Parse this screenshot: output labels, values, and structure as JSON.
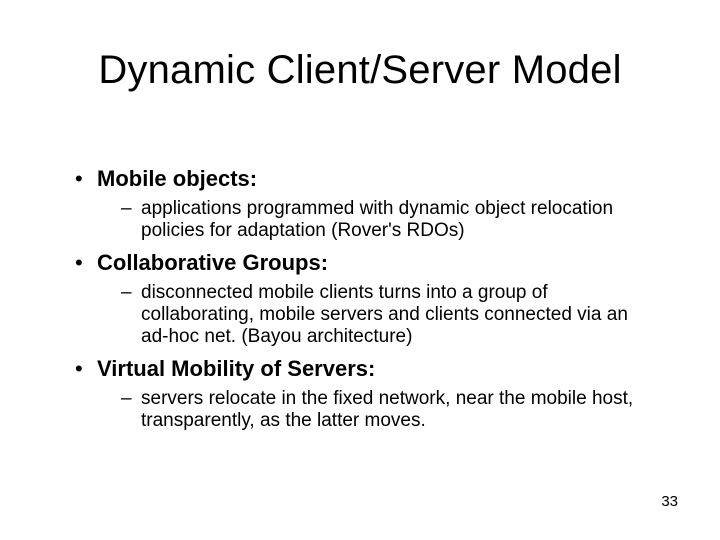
{
  "title": "Dynamic Client/Server Model",
  "bullets": {
    "b1": {
      "label": "Mobile objects:",
      "sub": "applications programmed with dynamic object relocation policies for adaptation (Rover's RDOs)"
    },
    "b2": {
      "label": "Collaborative Groups:",
      "sub": "disconnected mobile clients turns into a group of collaborating, mobile servers and clients connected via an ad-hoc net. (Bayou architecture)"
    },
    "b3": {
      "label": "Virtual Mobility of Servers:",
      "sub": "servers relocate in the fixed network, near the mobile host, transparently, as the latter moves."
    }
  },
  "page_number": "33",
  "glyphs": {
    "bullet": "•",
    "dash": "–"
  }
}
